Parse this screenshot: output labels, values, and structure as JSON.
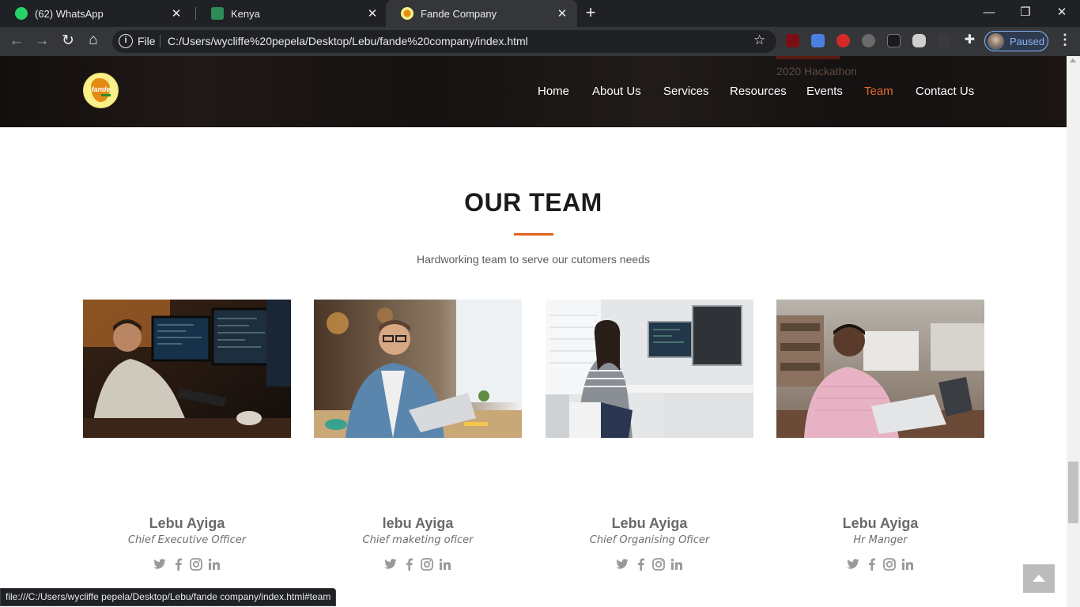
{
  "browser": {
    "tabs": [
      {
        "title": "(62) WhatsApp",
        "icon": "whatsapp-icon",
        "active": false
      },
      {
        "title": "Kenya",
        "icon": "sheets-icon",
        "active": false
      },
      {
        "title": "Fande Company",
        "icon": "fande-logo-icon",
        "active": true
      }
    ],
    "scheme_label": "File",
    "url": "C:/Users/wycliffe%20pepela/Desktop/Lebu/fande%20company/index.html",
    "profile_label": "Paused",
    "status_url": "file:///C:/Users/wycliffe pepela/Desktop/Lebu/fande company/index.html#team"
  },
  "header": {
    "logo_text": "fande",
    "ghost_text": "2020 Hackathon",
    "nav": [
      "Home",
      "About Us",
      "Services",
      "Resources",
      "Events",
      "Team",
      "Contact Us"
    ],
    "active_nav": "Team"
  },
  "team_section": {
    "title": "OUR TEAM",
    "subtitle": "Hardworking team to serve our cutomers needs",
    "members": [
      {
        "name": "Lebu Ayiga",
        "role": "Chief Executive Officer"
      },
      {
        "name": "lebu Ayiga",
        "role": "Chief maketing oficer"
      },
      {
        "name": "Lebu Ayiga",
        "role": "Chief Organising Oficer"
      },
      {
        "name": "Lebu Ayiga",
        "role": "Hr Manger"
      }
    ]
  },
  "colors": {
    "accent": "#e96b28",
    "chrome_dark": "#202124",
    "chrome_toolbar": "#35363a",
    "profile_blue": "#8ab4f8"
  }
}
